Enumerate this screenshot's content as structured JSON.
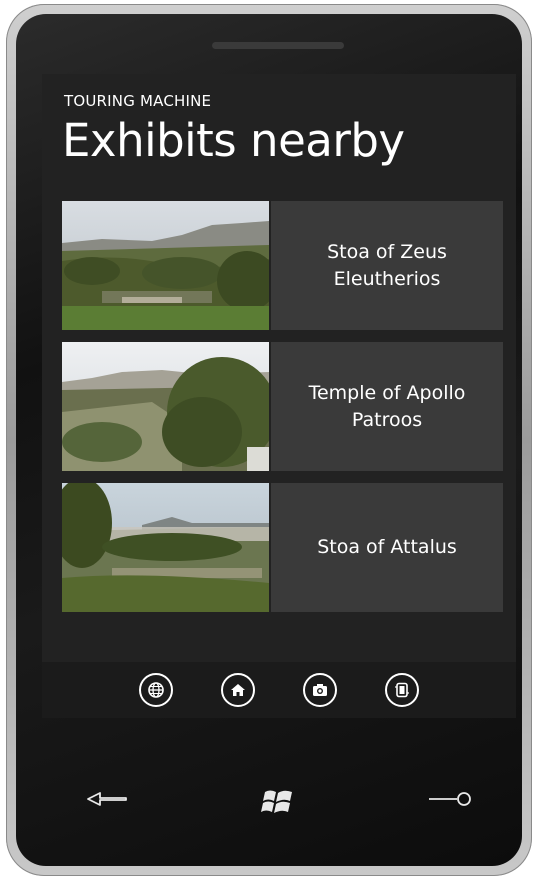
{
  "app": {
    "title": "TOURING MACHINE"
  },
  "page": {
    "title": "Exhibits nearby"
  },
  "exhibits": [
    {
      "label": "Stoa of Zeus Eleutherios"
    },
    {
      "label": "Temple of Apollo Patroos"
    },
    {
      "label": "Stoa of Attalus"
    }
  ],
  "app_bar": {
    "buttons": [
      {
        "icon": "globe-icon"
      },
      {
        "icon": "home-icon"
      },
      {
        "icon": "camera-icon"
      },
      {
        "icon": "device-icon"
      }
    ]
  },
  "hardware_buttons": [
    {
      "icon": "back-arrow-icon"
    },
    {
      "icon": "windows-start-icon"
    },
    {
      "icon": "search-icon"
    }
  ],
  "colors": {
    "screen_bg": "#222222",
    "tile_bg": "#3a3a3a",
    "text": "#ffffff"
  }
}
